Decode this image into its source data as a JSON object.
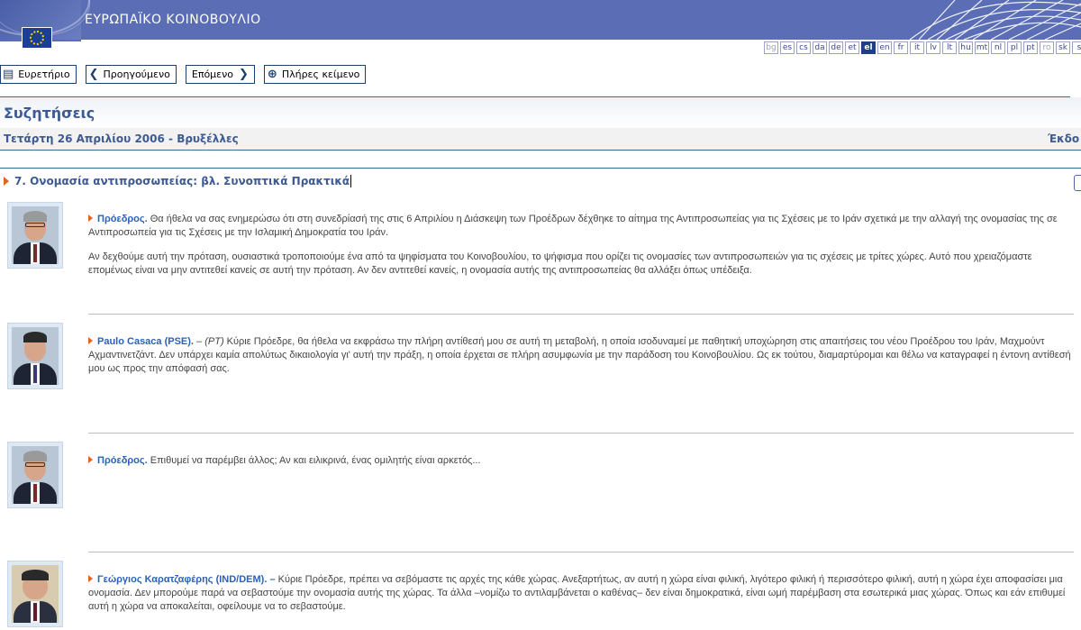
{
  "header": {
    "title": "ΕΥΡΩΠΑΪΚΟ ΚΟΙΝΟΒΟΥΛΙΟ"
  },
  "languages": [
    "bg",
    "es",
    "cs",
    "da",
    "de",
    "et",
    "el",
    "en",
    "fr",
    "it",
    "lv",
    "lt",
    "hu",
    "mt",
    "nl",
    "pl",
    "pt",
    "ro",
    "sk",
    "s"
  ],
  "active_language": "el",
  "toolbar": {
    "index_label": "Ευρετήριο",
    "previous_label": "Προηγούμενο",
    "next_label": "Επόμενο",
    "fulltext_label": "Πλήρες κείμενο"
  },
  "page": {
    "title": "Συζητήσεις",
    "date": "Τετάρτη 26 Απριλίου 2006 - Βρυξέλλες",
    "edition": "Έκδο"
  },
  "section": {
    "title": "7. Ονομασία αντιπροσωπείας: βλ. Συνοπτικά Πρακτικά"
  },
  "speeches": [
    {
      "speaker": "Πρόεδρος.",
      "paragraphs": [
        " Θα ήθελα να σας ενημερώσω ότι στη συνεδρίασή της στις 6 Απριλίου η Διάσκεψη των Προέδρων δέχθηκε το αίτημα της Αντιπροσωπείας για τις Σχέσεις με το Ιράν σχετικά με την αλλαγή της ονομασίας της σε Αντιπροσωπεία για τις Σχέσεις με την Ισλαμική Δημοκρατία του Ιράν.",
        "Αν δεχθούμε αυτή την πρόταση, ουσιαστικά τροποποιούμε ένα από τα ψηφίσματα του Κοινοβουλίου, το ψήφισμα που ορίζει τις ονομασίες των αντιπροσωπειών για τις σχέσεις με τρίτες χώρες. Αυτό που χρειαζόμαστε επομένως είναι να μην αντιτεθεί κανείς σε αυτή την πρόταση. Αν δεν αντιτεθεί κανείς, η ονομασία αυτής της αντιπροσωπείας θα αλλάξει όπως υπέδειξα."
      ]
    },
    {
      "speaker": "Paulo Casaca (PSE).",
      "dash": " – ",
      "lang_tag": "(PT)",
      "paragraphs": [
        " Κύριε Πρόεδρε, θα ήθελα να εκφράσω την πλήρη αντίθεσή μου σε αυτή τη μεταβολή, η οποία ισοδυναμεί με παθητική υποχώρηση στις απαιτήσεις του νέου Προέδρου του Ιράν, Μαχμούντ Αχμαντινετζάντ. Δεν υπάρχει καμία απολύτως δικαιολογία γι' αυτή την πράξη, η οποία έρχεται σε πλήρη ασυμφωνία με την παράδοση του Κοινοβουλίου. Ως εκ τούτου, διαμαρτύρομαι και θέλω να καταγραφεί η έντονη αντίθεσή μου ως προς την απόφασή σας."
      ]
    },
    {
      "speaker": "Πρόεδρος.",
      "paragraphs": [
        " Επιθυμεί να παρέμβει άλλος; Αν και ειλικρινά, ένας ομιλητής είναι αρκετός..."
      ]
    },
    {
      "speaker": "Γεώργιος Καρατζαφέρης (IND/DEM).",
      "dash": " – ",
      "paragraphs": [
        "Κύριε Πρόεδρε, πρέπει να σεβόμαστε τις αρχές της κάθε χώρας. Ανεξαρτήτως, αν αυτή η χώρα είναι φιλική, λιγότερο φιλική ή περισσότερο φιλική, αυτή η χώρα έχει αποφασίσει μια ονομασία. Δεν μπορούμε παρά να σεβαστούμε την ονομασία αυτής της χώρας. Τα άλλα –νομίζω το αντιλαμβάνεται ο καθένας– δεν είναι δημοκρατικά, είναι ωμή παρέμβαση στα εσωτερικά μιας χώρας. Όπως και εάν επιθυμεί αυτή η χώρα να αποκαλείται, οφείλουμε να το σεβαστούμε."
      ]
    }
  ],
  "icons": {
    "index": "list-icon",
    "previous": "chevron-left-icon",
    "next": "chevron-right-icon",
    "fulltext": "plus-circle-icon"
  },
  "colors": {
    "banner": "#5b6eb5",
    "title": "#3e5a92",
    "speaker": "#2a62b8",
    "bullet": "#e0661c"
  }
}
